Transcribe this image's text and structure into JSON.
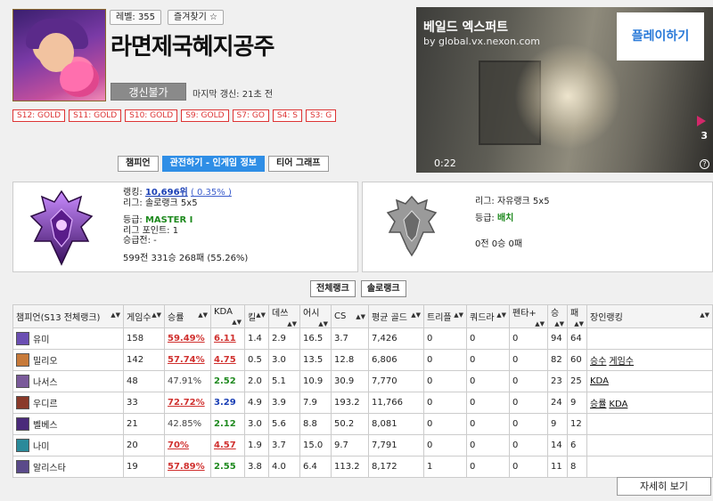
{
  "header": {
    "level_label": "레벨: 355",
    "favorite_label": "즐겨찾기 ☆",
    "summoner_name": "라면제국혜지공주",
    "renew_label": "갱신불가",
    "last_update": "마지막 갱신: 21초 전",
    "past_tiers": [
      "S12: GOLD",
      "S11: GOLD",
      "S10: GOLD",
      "S9: GOLD",
      "S7: GO",
      "S4: S",
      "S3: G"
    ]
  },
  "ad": {
    "title": "베일드 엑스퍼트",
    "url": "by global.vx.nexon.com",
    "play_label": "플레이하기",
    "time": "0:22",
    "count": "3",
    "info_icon": "info-icon"
  },
  "tabs": [
    {
      "label": "챔피언",
      "active": false
    },
    {
      "label": "관전하기 - 인게임 정보",
      "active": true
    },
    {
      "label": "티어 그래프",
      "active": false
    }
  ],
  "solo_rank": {
    "ranking_prefix": "랭킹: ",
    "ranking_value": "10,696위",
    "ranking_pct": "( 0.35% )",
    "league": "리그: 솔로랭크 5x5",
    "tier_prefix": "등급: ",
    "tier_value": "MASTER I",
    "lp": "리그 포인트: 1",
    "promo": "승급전: -",
    "record": "599전 331승 268패 (55.26%)"
  },
  "flex_rank": {
    "league": "리그: 자유랭크 5x5",
    "tier_prefix": "등급: ",
    "tier_value": "배치",
    "record": "0전 0승 0패"
  },
  "rank_toggle": [
    "전체랭크",
    "솔로랭크"
  ],
  "table": {
    "headers": [
      "챔피언(S13 전체랭크)",
      "게임수",
      "승률",
      "KDA",
      "킬",
      "데쓰",
      "어시",
      "CS",
      "평균 골드",
      "트리플",
      "쿼드라",
      "펜타+",
      "승",
      "패",
      "장인랭킹"
    ],
    "rows": [
      {
        "name": "유미",
        "games": "158",
        "winrate": "59.49%",
        "wr_style": "red",
        "kda": "6.11",
        "kda_style": "red",
        "kill": "1.4",
        "death": "2.9",
        "assist": "16.5",
        "cs": "3.7",
        "gold": "7,426",
        "triple": "0",
        "quadra": "0",
        "penta": "0",
        "win": "94",
        "lose": "64",
        "tags": [],
        "color": "#6b4fb3"
      },
      {
        "name": "밀리오",
        "games": "142",
        "winrate": "57.74%",
        "wr_style": "red",
        "kda": "4.75",
        "kda_style": "red",
        "kill": "0.5",
        "death": "3.0",
        "assist": "13.5",
        "cs": "12.8",
        "gold": "6,806",
        "triple": "0",
        "quadra": "0",
        "penta": "0",
        "win": "82",
        "lose": "60",
        "tags": [
          "승수",
          "게임수"
        ],
        "color": "#c77a3a"
      },
      {
        "name": "나서스",
        "games": "48",
        "winrate": "47.91%",
        "wr_style": "plain",
        "kda": "2.52",
        "kda_style": "green",
        "kill": "2.0",
        "death": "5.1",
        "assist": "10.9",
        "cs": "30.9",
        "gold": "7,770",
        "triple": "0",
        "quadra": "0",
        "penta": "0",
        "win": "23",
        "lose": "25",
        "tags": [
          "KDA"
        ],
        "color": "#7a5a9a"
      },
      {
        "name": "우디르",
        "games": "33",
        "winrate": "72.72%",
        "wr_style": "red",
        "kda": "3.29",
        "kda_style": "blue",
        "kill": "4.9",
        "death": "3.9",
        "assist": "7.9",
        "cs": "193.2",
        "gold": "11,766",
        "triple": "0",
        "quadra": "0",
        "penta": "0",
        "win": "24",
        "lose": "9",
        "tags": [
          "승률",
          "KDA"
        ],
        "color": "#8a3a2a"
      },
      {
        "name": "벨베스",
        "games": "21",
        "winrate": "42.85%",
        "wr_style": "plain",
        "kda": "2.12",
        "kda_style": "green",
        "kill": "3.0",
        "death": "5.6",
        "assist": "8.8",
        "cs": "50.2",
        "gold": "8,081",
        "triple": "0",
        "quadra": "0",
        "penta": "0",
        "win": "9",
        "lose": "12",
        "tags": [],
        "color": "#4a2a7a"
      },
      {
        "name": "나미",
        "games": "20",
        "winrate": "70%",
        "wr_style": "red",
        "kda": "4.57",
        "kda_style": "red",
        "kill": "1.9",
        "death": "3.7",
        "assist": "15.0",
        "cs": "9.7",
        "gold": "7,791",
        "triple": "0",
        "quadra": "0",
        "penta": "0",
        "win": "14",
        "lose": "6",
        "tags": [],
        "color": "#2a8a9a"
      },
      {
        "name": "알리스타",
        "games": "19",
        "winrate": "57.89%",
        "wr_style": "red",
        "kda": "2.55",
        "kda_style": "green",
        "kill": "3.8",
        "death": "4.0",
        "assist": "6.4",
        "cs": "113.2",
        "gold": "8,172",
        "triple": "1",
        "quadra": "0",
        "penta": "0",
        "win": "11",
        "lose": "8",
        "tags": [],
        "color": "#5a4a8a"
      }
    ]
  },
  "more_label": "자세히 보기"
}
